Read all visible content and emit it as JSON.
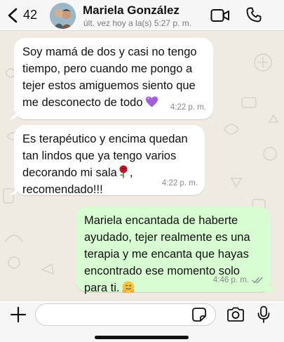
{
  "header": {
    "back_count": "42",
    "contact_name": "Mariela González",
    "status": "últ. vez hoy a la(s)  5:27 p. m."
  },
  "messages": [
    {
      "direction": "incoming",
      "text": "Soy mamá de dos y casi no tengo tiempo, pero cuando me pongo a tejer estos amiguemos siento que me desconecto de todo",
      "emoji": "purple-heart",
      "time": "4:22 p. m."
    },
    {
      "direction": "incoming",
      "text_before_emoji": "Es terapéutico y encima quedan tan lindos que ya tengo varios decorando mi sala",
      "emoji": "rose",
      "text_after_emoji": ", recomendado!!!",
      "time": "4:22 p. m."
    },
    {
      "direction": "outgoing",
      "text": "Mariela encantada de haberte ayudado, tejer realmente es una terapia y me encanta que hayas encontrado ese momento solo para ti.",
      "emoji": "hugging-face",
      "time": "4:46 p. m.",
      "status": "read"
    }
  ],
  "composer": {
    "value": "",
    "placeholder": ""
  },
  "colors": {
    "chat_background": "#efeae2",
    "incoming_bubble": "#ffffff",
    "outgoing_bubble": "#d9fdd3",
    "read_ticks": "#8a8a8a"
  }
}
